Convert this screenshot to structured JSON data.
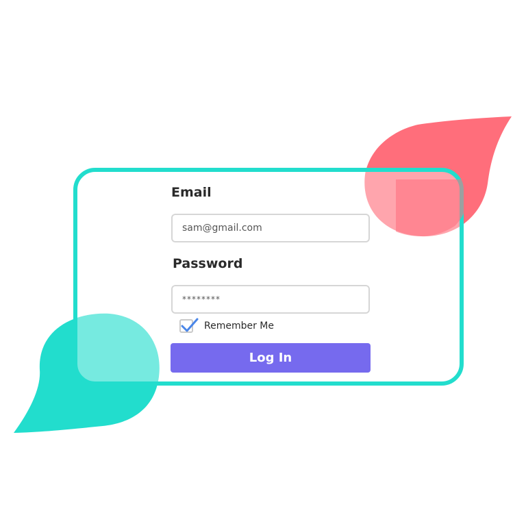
{
  "colors": {
    "accent_teal": "#22DDCD",
    "accent_red": "#FF6E7B",
    "button": "#766AEE"
  },
  "form": {
    "email_label": "Email",
    "email_value": "sam@gmail.com",
    "password_label": "Password",
    "password_value": "********",
    "remember_label": "Remember Me",
    "remember_checked": true,
    "login_label": "Log In"
  },
  "icons": {
    "checkbox": "checkmark-icon"
  }
}
